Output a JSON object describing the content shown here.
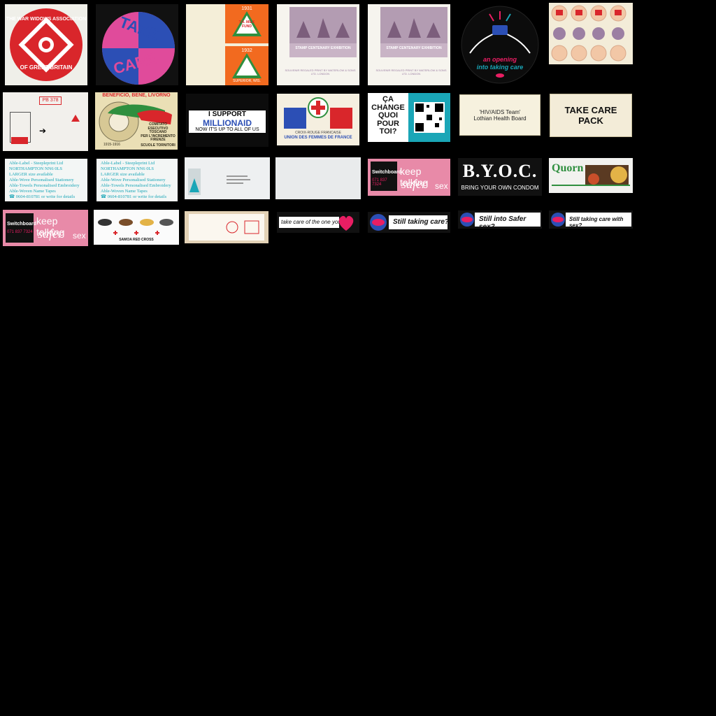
{
  "tiles": {
    "t1": {
      "line1": "THE WAR WIDOWS ASSOCIATION",
      "line2": "OF GREAT BRITAIN"
    },
    "t2": {
      "line1": "TAKE",
      "line2": "CARE"
    },
    "t3": {
      "year_a": "1931",
      "year_b": "1932",
      "tree_text": "T.A. MILK FUND",
      "foot": "SUPERIOR, WIS."
    },
    "t4": {
      "title": "STAMP CENTENARY EXHIBITION",
      "foot": "SOUVENIR REGALED PRINT BY WATERLOW & SONS LTD. LONDON"
    },
    "t5": {
      "title": "STAMP CENTENARY EXHIBITION",
      "foot": "SOUVENIR REGALED PRINT BY WATERLOW & SONS LTD. LONDON"
    },
    "t6": {
      "line1": "an opening",
      "line2": "into taking care"
    },
    "t8": {
      "code": "PB 378"
    },
    "t9": {
      "top": "BENEFICIO, BENE, LIVORNO",
      "center1": "COMITATO ESECUTIVO",
      "center2": "TOSCANO",
      "center3": "PER L'INCREMENTO",
      "city": "FIRENZE",
      "years": "1915-1916",
      "bottom": "SCUOLE TORNITORI"
    },
    "t10": {
      "line1": "I SUPPORT",
      "brand": "MILLIONAID",
      "line3": "NOW IT'S UP TO ALL OF US"
    },
    "t11": {
      "top": "CROIX-ROUGE FRANCAISE",
      "bottom": "UNION DES FEMMES DE FRANCE"
    },
    "t12": {
      "l1": "ÇA",
      "l2": "CHANGE",
      "l3": "QUOI POUR",
      "l4": "TOI?"
    },
    "t13": {
      "line1": "'HIV/AIDS Team'",
      "line2": "Lothian Health Board"
    },
    "t14": {
      "line1": "TAKE CARE",
      "line2": "PACK"
    },
    "t15": {
      "lines": [
        "Able-Label - Steepleprint Ltd",
        "NORTHAMPTON   NN6 0LS",
        "LARGER size available",
        "Able-Wove Personalised Stationery",
        "Able-Towels Personalised Embroidery",
        "Able-Woven Name Tapes",
        "☎ 0604-810781 or write for details"
      ]
    },
    "t16": {
      "lines": [
        "Able-Label - Steepleprint Ltd",
        "NORTHAMPTON   NN6 0LS",
        "LARGER size available",
        "Able-Wove Personalised Stationery",
        "Able-Towels Personalised Embroidery",
        "Able-Woven Name Tapes",
        "☎ 0604-810781 or write for details"
      ]
    },
    "t19": {
      "brand": "Switchboard",
      "phone": "071 837 7324",
      "l1": "keep talking",
      "l2": "safer",
      "l3": "sex"
    },
    "t20": {
      "brand": "B.Y.O.C.",
      "sub": "BRING YOUR OWN CONDOM"
    },
    "t21": {
      "brand": "Quorn"
    },
    "t22": {
      "brand": "Switchboard",
      "phone": "071 837 7324",
      "l1": "keep talking",
      "l2": "safer",
      "l3": "sex"
    },
    "t23": {
      "label": "SAMOA RED CROSS"
    },
    "t25": {
      "text": "take care of the one you"
    },
    "t26": {
      "text": "Still taking care?"
    },
    "t27": {
      "text": "Still into Safer sex?"
    },
    "t28": {
      "text": "Still taking care with sex?"
    }
  },
  "colors": {
    "red": "#d9262b",
    "pink": "#e04b9b",
    "blue": "#2c4fb5",
    "orange": "#f26a1f",
    "green": "#2f8f3f",
    "teal": "#1aa6b7",
    "lilac": "#9c7fa3",
    "cream": "#f3ecd8",
    "magenta": "#e91e63"
  }
}
